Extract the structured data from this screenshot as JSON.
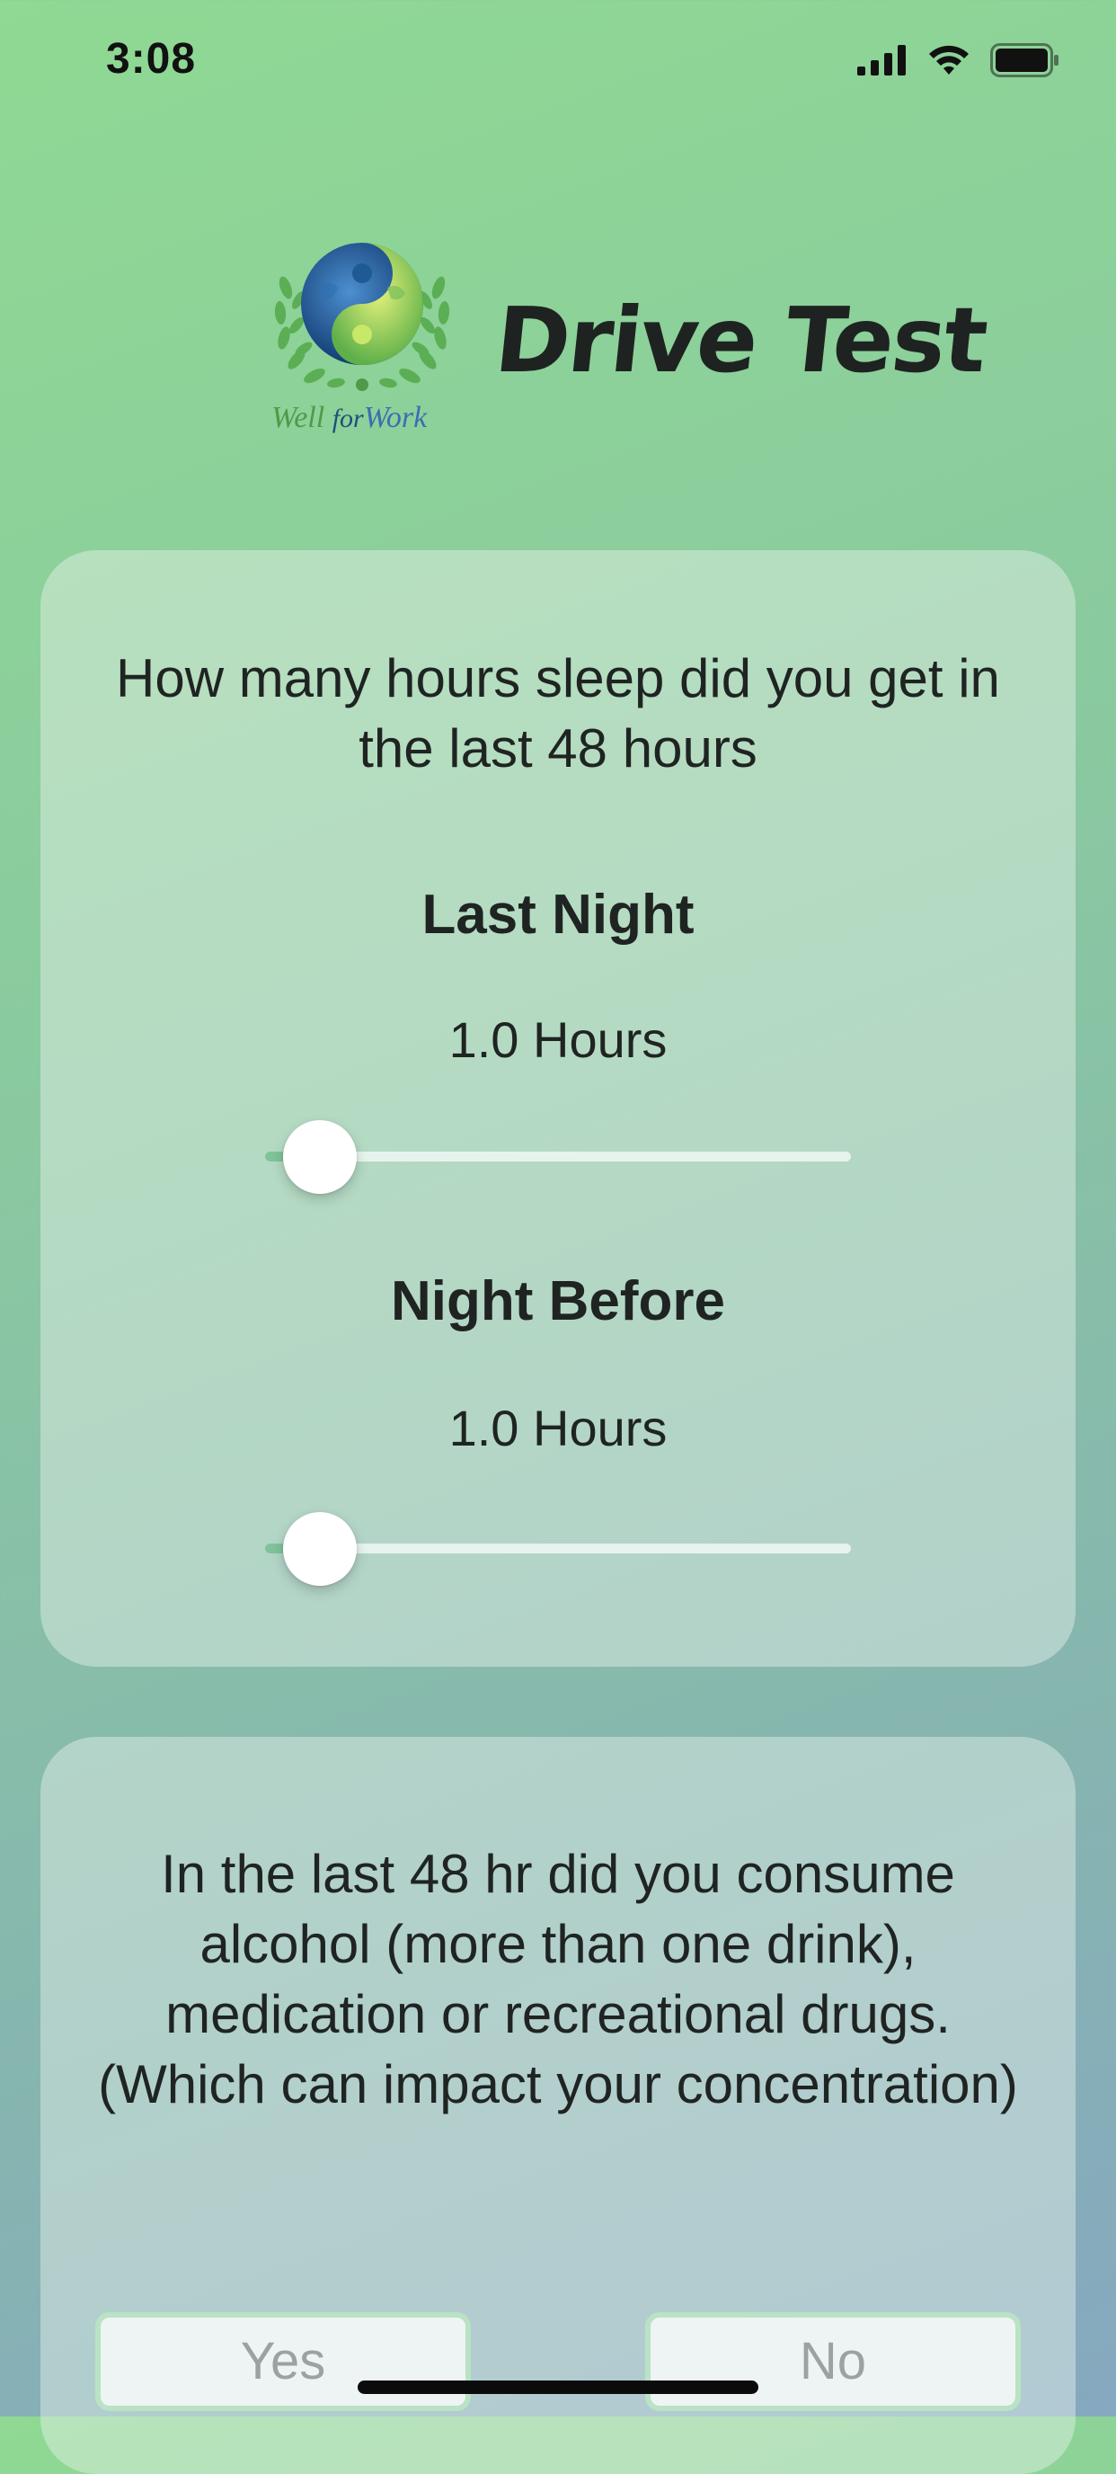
{
  "status_bar": {
    "time": "3:08"
  },
  "header": {
    "logo_words": [
      "Well",
      "for",
      "Work"
    ],
    "title": "Drive Test"
  },
  "sleep_card": {
    "question": "How many hours sleep did you get in the last 48 hours",
    "sliders": [
      {
        "label": "Last Night",
        "value_text": "1.0 Hours",
        "value": 1.0
      },
      {
        "label": "Night Before",
        "value_text": "1.0 Hours",
        "value": 1.0
      }
    ]
  },
  "substance_card": {
    "question": "In the last 48 hr did you consume alcohol (more than one drink), medication or recreational drugs. (Which can impact your concentration)",
    "yes_label": "Yes",
    "no_label": "No"
  },
  "colors": {
    "accent": "#7ec39a",
    "button_border": "#b9e3c4"
  }
}
